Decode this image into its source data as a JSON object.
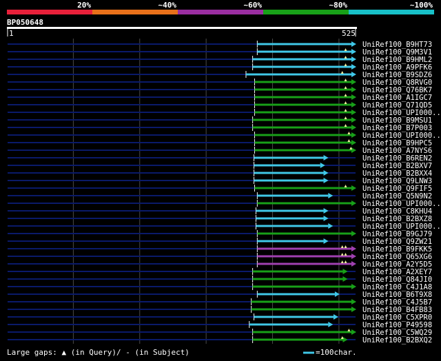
{
  "query": {
    "id": "BP050648",
    "start_label": "1",
    "end_label": "525",
    "length": 525
  },
  "identity_legend": [
    {
      "label": "",
      "color": "#e8203a"
    },
    {
      "label": "20%",
      "color": "#e8701a"
    },
    {
      "label": "~40%",
      "color": "#9a2ea0"
    },
    {
      "label": "~60%",
      "color": "#18a018"
    },
    {
      "label": "~80%",
      "color": "#18c0c8"
    },
    {
      "label": "~100%",
      "color": ""
    }
  ],
  "footer": {
    "gaps_prefix": "Large gaps:",
    "gaps_query": "(in Query)/",
    "gaps_subject": "- (in Subject)",
    "scale_label": "=100char."
  },
  "colors": {
    "background": "#000000",
    "track": "#0a1a6a",
    "grid": "#4a4a4a",
    "cyan": "#40c8e8",
    "green": "#18a018",
    "purple": "#a040b0",
    "gap_marker": "#f0f0a0"
  },
  "chart_data": {
    "type": "alignment",
    "x_unit": "residue",
    "xlim": [
      1,
      525
    ],
    "hits": [
      {
        "name": "UniRef100_B9HT73",
        "start": 377,
        "end": 525,
        "color": "cyan",
        "query_gaps": []
      },
      {
        "name": "UniRef100_Q9M3V1",
        "start": 377,
        "end": 525,
        "color": "cyan",
        "query_gaps": [
          510
        ]
      },
      {
        "name": "UniRef100_B9HML2",
        "start": 370,
        "end": 525,
        "color": "cyan",
        "query_gaps": [
          510
        ]
      },
      {
        "name": "UniRef100_A9PFK6",
        "start": 370,
        "end": 525,
        "color": "cyan",
        "query_gaps": [
          510
        ]
      },
      {
        "name": "UniRef100_B9SDZ6",
        "start": 360,
        "end": 525,
        "color": "cyan",
        "query_gaps": [
          505
        ]
      },
      {
        "name": "UniRef100_Q8RVG0",
        "start": 373,
        "end": 525,
        "color": "green",
        "query_gaps": [
          510
        ]
      },
      {
        "name": "UniRef100_Q76BK7",
        "start": 373,
        "end": 525,
        "color": "green",
        "query_gaps": [
          510
        ]
      },
      {
        "name": "UniRef100_A1IGC7",
        "start": 373,
        "end": 525,
        "color": "green",
        "query_gaps": [
          510
        ]
      },
      {
        "name": "UniRef100_Q71QD5",
        "start": 373,
        "end": 525,
        "color": "green",
        "query_gaps": [
          510
        ]
      },
      {
        "name": "UniRef100_UPI000..",
        "start": 373,
        "end": 525,
        "color": "green",
        "query_gaps": [
          510
        ]
      },
      {
        "name": "UniRef100_B9MSU1",
        "start": 370,
        "end": 525,
        "color": "green",
        "query_gaps": [
          510
        ]
      },
      {
        "name": "UniRef100_B7P003",
        "start": 370,
        "end": 525,
        "color": "green",
        "query_gaps": [
          510
        ]
      },
      {
        "name": "UniRef100_UPI000..",
        "start": 373,
        "end": 525,
        "color": "green",
        "query_gaps": [
          515
        ]
      },
      {
        "name": "UniRef100_B9HPC5",
        "start": 373,
        "end": 525,
        "color": "green",
        "query_gaps": [
          515
        ]
      },
      {
        "name": "UniRef100_A7NYS6",
        "start": 373,
        "end": 525,
        "color": "green",
        "query_gaps": [
          518
        ]
      },
      {
        "name": "UniRef100_B6REN2",
        "start": 372,
        "end": 483,
        "color": "cyan",
        "query_gaps": []
      },
      {
        "name": "UniRef100_B2BXV7",
        "start": 372,
        "end": 478,
        "color": "cyan",
        "query_gaps": []
      },
      {
        "name": "UniRef100_B2BXX4",
        "start": 372,
        "end": 483,
        "color": "cyan",
        "query_gaps": []
      },
      {
        "name": "UniRef100_Q9LNW3",
        "start": 372,
        "end": 483,
        "color": "cyan",
        "query_gaps": []
      },
      {
        "name": "UniRef100_Q9FIF5",
        "start": 373,
        "end": 525,
        "color": "green",
        "query_gaps": [
          510
        ]
      },
      {
        "name": "UniRef100_Q5N9N2",
        "start": 377,
        "end": 490,
        "color": "cyan",
        "query_gaps": []
      },
      {
        "name": "UniRef100_UPI000..",
        "start": 377,
        "end": 525,
        "color": "green",
        "query_gaps": []
      },
      {
        "name": "UniRef100_C8KHU4",
        "start": 375,
        "end": 483,
        "color": "cyan",
        "query_gaps": []
      },
      {
        "name": "UniRef100_B2BXZ8",
        "start": 375,
        "end": 483,
        "color": "cyan",
        "query_gaps": []
      },
      {
        "name": "UniRef100_UPI000..",
        "start": 375,
        "end": 490,
        "color": "cyan",
        "query_gaps": []
      },
      {
        "name": "UniRef100_B9GJ79",
        "start": 377,
        "end": 525,
        "color": "green",
        "query_gaps": []
      },
      {
        "name": "UniRef100_Q9ZW21",
        "start": 377,
        "end": 483,
        "color": "cyan",
        "query_gaps": []
      },
      {
        "name": "UniRef100_B9FKK5",
        "start": 377,
        "end": 525,
        "color": "purple",
        "query_gaps": [
          505,
          510
        ]
      },
      {
        "name": "UniRef100_Q65XG6",
        "start": 377,
        "end": 525,
        "color": "purple",
        "query_gaps": [
          505,
          510
        ]
      },
      {
        "name": "UniRef100_A2Y5D5",
        "start": 377,
        "end": 525,
        "color": "purple",
        "query_gaps": [
          505,
          510
        ]
      },
      {
        "name": "UniRef100_A2XEY7",
        "start": 370,
        "end": 512,
        "color": "green",
        "query_gaps": []
      },
      {
        "name": "UniRef100_Q84JI0",
        "start": 370,
        "end": 512,
        "color": "green",
        "query_gaps": []
      },
      {
        "name": "UniRef100_C4J1A8",
        "start": 370,
        "end": 525,
        "color": "green",
        "query_gaps": []
      },
      {
        "name": "UniRef100_B6T9X8",
        "start": 377,
        "end": 500,
        "color": "cyan",
        "query_gaps": []
      },
      {
        "name": "UniRef100_C4J5B7",
        "start": 368,
        "end": 525,
        "color": "green",
        "query_gaps": []
      },
      {
        "name": "UniRef100_B4FB83",
        "start": 368,
        "end": 525,
        "color": "green",
        "query_gaps": []
      },
      {
        "name": "UniRef100_C5XPR0",
        "start": 372,
        "end": 498,
        "color": "cyan",
        "query_gaps": []
      },
      {
        "name": "UniRef100_P49598",
        "start": 365,
        "end": 490,
        "color": "cyan",
        "query_gaps": []
      },
      {
        "name": "UniRef100_C5WQ29",
        "start": 370,
        "end": 525,
        "color": "green",
        "query_gaps": [
          515
        ]
      },
      {
        "name": "UniRef100_B2BXQ2",
        "start": 370,
        "end": 512,
        "color": "green",
        "query_gaps": [
          505
        ]
      }
    ]
  }
}
